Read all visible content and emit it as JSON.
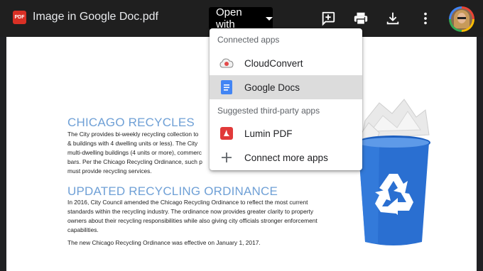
{
  "header": {
    "file_icon_text": "PDF",
    "file_name": "Image in Google Doc.pdf",
    "open_with_label": "Open with"
  },
  "menu": {
    "connected_heading": "Connected apps",
    "connected": [
      {
        "label": "CloudConvert",
        "icon": "cloudconvert-icon"
      },
      {
        "label": "Google Docs",
        "icon": "google-docs-icon",
        "selected": true
      }
    ],
    "suggested_heading": "Suggested third-party apps",
    "suggested": [
      {
        "label": "Lumin PDF",
        "icon": "lumin-pdf-icon"
      },
      {
        "label": "Connect more apps",
        "icon": "plus-icon"
      }
    ]
  },
  "document": {
    "heading1": "CHICAGO RECYCLES",
    "para1": [
      "The City provides bi-weekly recycling collection to",
      "& buildings with 4 dwelling units or less).  The City",
      "multi-dwelling buildings (4 units or more), commerc",
      "bars. Per the Chicago Recycling Ordinance, such p",
      "must provide recycling services."
    ],
    "heading2": "UPDATED RECYCLING ORDINANCE",
    "para2": [
      "In 2016, City Council amended the Chicago Recycling Ordinance to reflect the most current",
      "standards within the recycling industry. The ordinance now provides greater clarity to property",
      "owners about their recycling responsibilities while also giving city officials stronger enforcement",
      "capabilities."
    ],
    "para3": "The new Chicago Recycling Ordinance was effective on January 1, 2017."
  },
  "colors": {
    "topbar": "#1f1f1f",
    "heading_blue": "#6fa0d6",
    "bin_blue": "#2a6fd1",
    "pdf_red": "#d93025"
  }
}
